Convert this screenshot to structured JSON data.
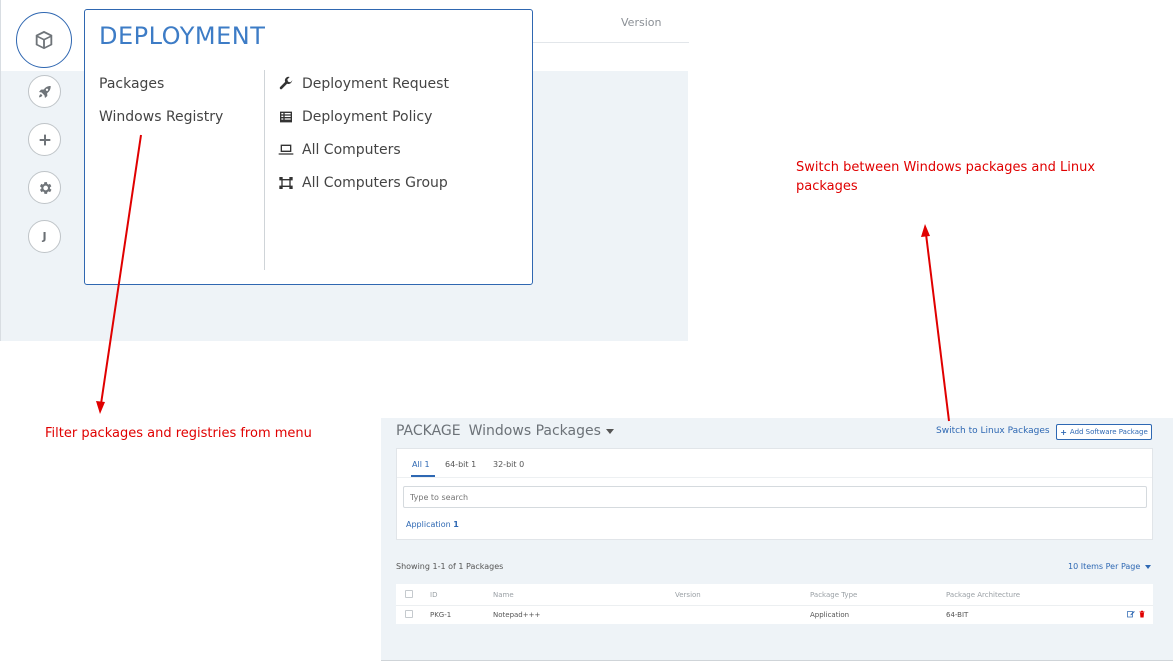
{
  "menu_screenshot": {
    "header_column": "Version",
    "title": "DEPLOYMENT",
    "left_items": [
      {
        "label": "Packages"
      },
      {
        "label": "Windows Registry"
      }
    ],
    "right_items": [
      {
        "label": "Deployment Request",
        "icon": "wrench-icon"
      },
      {
        "label": "Deployment Policy",
        "icon": "list-icon"
      },
      {
        "label": "All Computers",
        "icon": "laptop-icon"
      },
      {
        "label": "All Computers Group",
        "icon": "computer-group-icon"
      }
    ],
    "rail": [
      {
        "icon": "package-icon"
      },
      {
        "icon": "rocket-icon"
      },
      {
        "icon": "plus-icon"
      },
      {
        "icon": "gear-icon"
      },
      {
        "icon": "user-avatar-icon",
        "letter": "J"
      }
    ]
  },
  "annotations": {
    "filter_note": "Filter packages and registries from menu",
    "switch_note_line1": "Switch between Windows packages and Linux",
    "switch_note_line2": "packages",
    "color": "#e00000"
  },
  "package_screenshot": {
    "title": "PACKAGE",
    "subtitle": "Windows Packages",
    "switch_link": "Switch to Linux Packages",
    "add_button": "Add Software Package",
    "tabs": [
      {
        "label": "All",
        "count": "1"
      },
      {
        "label": "64-bit",
        "count": "1"
      },
      {
        "label": "32-bit",
        "count": "0"
      }
    ],
    "search_placeholder": "Type to search",
    "filter_label": "Application",
    "filter_count": "1",
    "showing": "Showing 1-1 of 1 Packages",
    "per_page": "10 Items Per Page",
    "columns": [
      "ID",
      "Name",
      "Version",
      "Package Type",
      "Package Architecture"
    ],
    "rows": [
      {
        "id": "PKG-1",
        "name": "Notepad+++",
        "version": "",
        "type": "Application",
        "arch": "64-BIT"
      }
    ],
    "accent": "#2e68b3"
  }
}
